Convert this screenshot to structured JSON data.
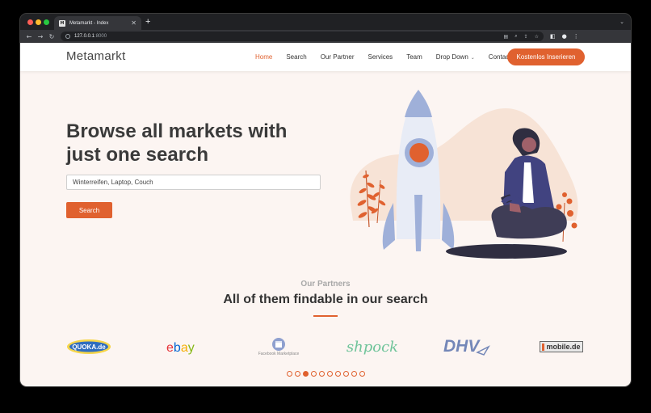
{
  "browser": {
    "tab_title": "Metamarkt - Index",
    "tab_favicon": "M",
    "tab_close": "✕",
    "new_tab": "+",
    "tab_menu": "⌄",
    "url_host": "127.0.0.1",
    "url_port": ":8000"
  },
  "site": {
    "logo": "Metamarkt",
    "accent_color": "#e0612f",
    "nav": [
      {
        "label": "Home",
        "active": true
      },
      {
        "label": "Search"
      },
      {
        "label": "Our Partner"
      },
      {
        "label": "Services"
      },
      {
        "label": "Team"
      },
      {
        "label": "Drop Down",
        "dropdown": true
      },
      {
        "label": "Contact"
      }
    ],
    "cta": "Kostenlos Inserieren"
  },
  "hero": {
    "title": "Browse all markets with just one search",
    "search_value": "Winterreifen, Laptop, Couch",
    "search_button": "Search"
  },
  "partners": {
    "subtitle": "Our Partners",
    "title": "All of them findable in our search",
    "logos": [
      "QUOKA.de",
      "ebay",
      "Facebook Marketplace",
      "shpock",
      "DHV",
      "mobile.de"
    ],
    "slides": 10,
    "active_slide": 3
  }
}
